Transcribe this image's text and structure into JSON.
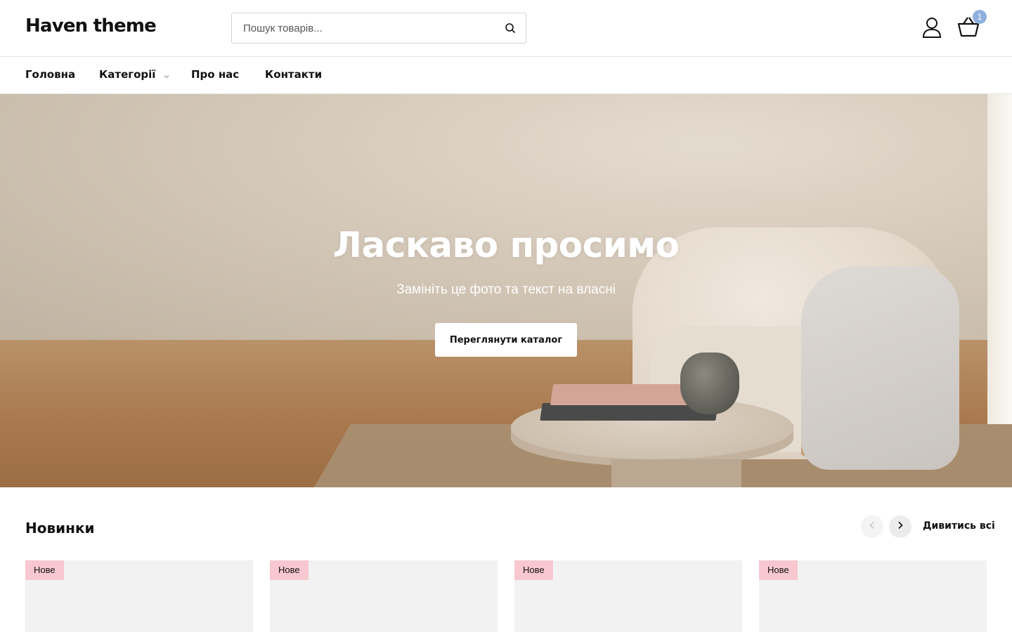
{
  "header": {
    "logo": "Haven theme",
    "search_placeholder": "Пошук товарів...",
    "search_icon": "search-icon",
    "account_icon": "user-icon",
    "cart_icon": "basket-icon",
    "cart_count": "1"
  },
  "nav": {
    "items": [
      {
        "label": "Головна"
      },
      {
        "label": "Категорії",
        "has_dropdown": true
      },
      {
        "label": "Про нас"
      },
      {
        "label": "Контакти"
      }
    ]
  },
  "hero": {
    "title": "Ласкаво просимо",
    "subtitle": "Замініть це фото та текст на власні",
    "button_label": "Переглянути каталог"
  },
  "new_arrivals": {
    "title": "Новинки",
    "view_all": "Дивитись всі",
    "prev_icon": "chevron-left-icon",
    "next_icon": "chevron-right-icon",
    "products": [
      {
        "badge": "Нове"
      },
      {
        "badge": "Нове"
      },
      {
        "badge": "Нове"
      },
      {
        "badge": "Нове"
      }
    ]
  },
  "colors": {
    "text": "#111111",
    "border": "#e5e5e5",
    "badge_bg": "#f8c7cf",
    "cart_badge": "#8fb0dc",
    "card_bg": "#f2f2f2"
  }
}
